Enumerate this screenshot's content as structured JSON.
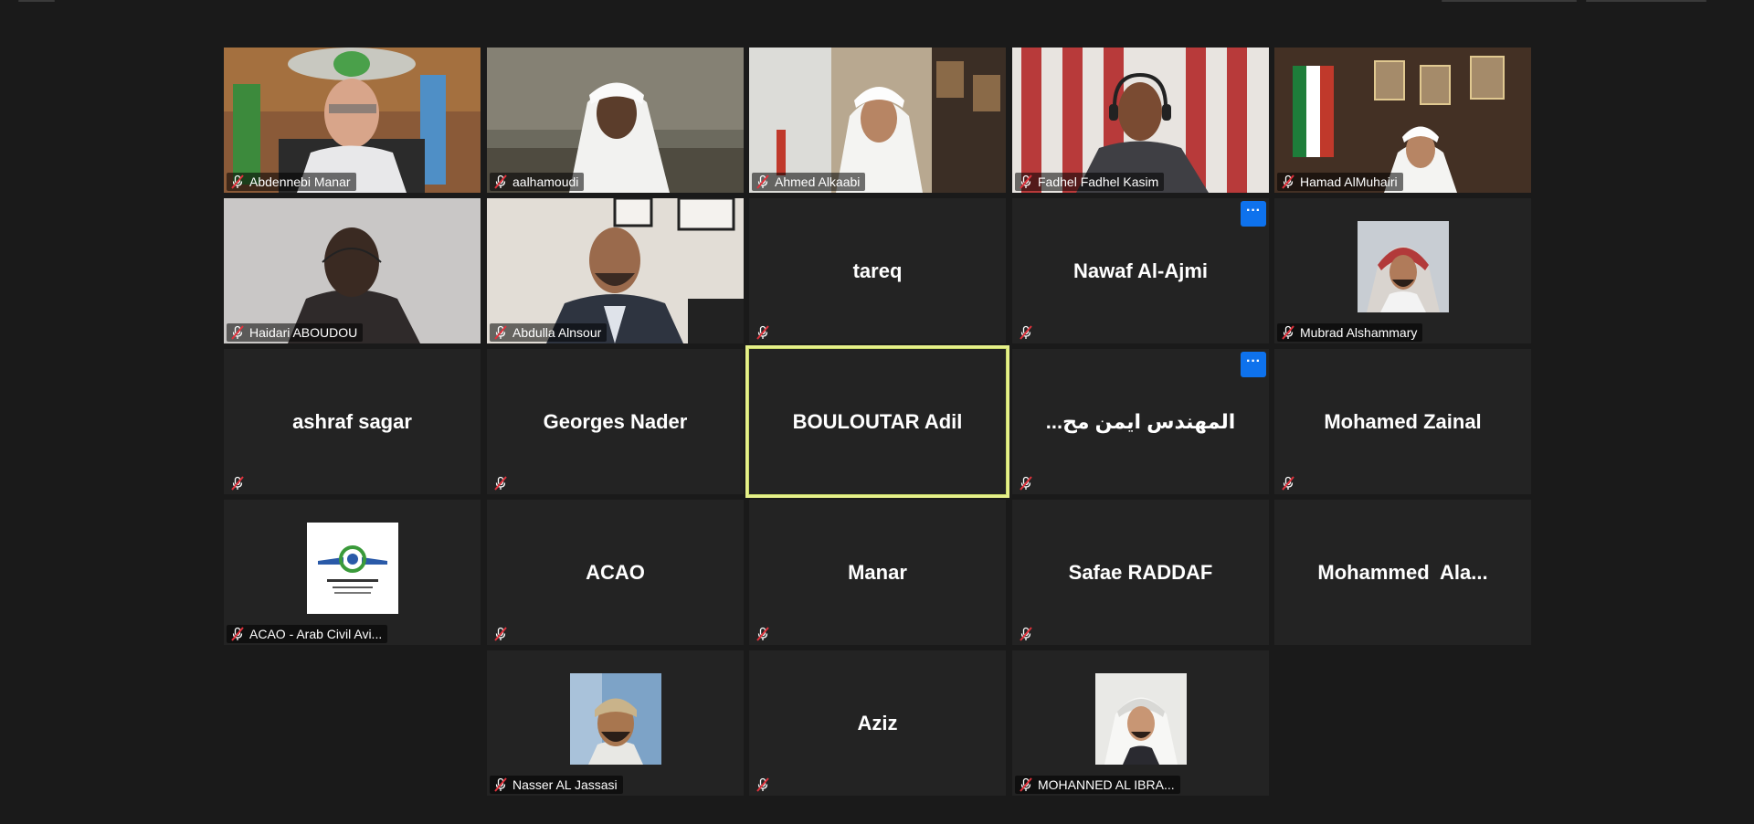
{
  "colors": {
    "background": "#1a1a1a",
    "tile_background": "#232323",
    "active_speaker_border": "#e6f08a",
    "more_button": "#0e72ed",
    "muted_icon": "#e0323c"
  },
  "gallery": {
    "participants": [
      {
        "name": "Abdennebi Manar",
        "muted": true,
        "video": true
      },
      {
        "name": "aalhamoudi",
        "muted": true,
        "video": true
      },
      {
        "name": "Ahmed Alkaabi",
        "muted": true,
        "video": true
      },
      {
        "name": "Fadhel Fadhel Kasim",
        "muted": true,
        "video": true
      },
      {
        "name": "Hamad AlMuhairi",
        "muted": true,
        "video": true
      },
      {
        "name": "Haidari ABOUDOU",
        "muted": true,
        "video": true
      },
      {
        "name": "Abdulla Alnsour",
        "muted": true,
        "video": true
      },
      {
        "name": "tareq",
        "muted": true,
        "video": false
      },
      {
        "name": "Nawaf Al-Ajmi",
        "muted": true,
        "video": false,
        "more_menu": "···"
      },
      {
        "name": "Mubrad Alshammary",
        "muted": true,
        "video": false,
        "avatar": "profile-photo"
      },
      {
        "name": "ashraf sagar",
        "muted": true,
        "video": false
      },
      {
        "name": "Georges Nader",
        "muted": true,
        "video": false
      },
      {
        "name": "BOULOUTAR Adil",
        "muted": false,
        "video": false,
        "active_speaker": true
      },
      {
        "name": "المهندس ايمن مح...",
        "muted": true,
        "video": false,
        "more_menu": "···"
      },
      {
        "name": "Mohamed Zainal",
        "muted": true,
        "video": false
      },
      {
        "name": "ACAO - Arab Civil Avi...",
        "muted": true,
        "video": false,
        "avatar": "acao-logo"
      },
      {
        "name": "ACAO",
        "muted": true,
        "video": false
      },
      {
        "name": "Manar",
        "muted": true,
        "video": false
      },
      {
        "name": "Safae RADDAF",
        "muted": true,
        "video": false
      },
      {
        "name": "Mohammed  Ala...",
        "muted": false,
        "video": false
      },
      {
        "name": "Nasser AL Jassasi",
        "muted": true,
        "video": false,
        "avatar": "profile-photo"
      },
      {
        "name": "Aziz",
        "muted": true,
        "video": false
      },
      {
        "name": "MOHANNED AL IBRA...",
        "muted": true,
        "video": false,
        "avatar": "profile-photo"
      }
    ]
  }
}
